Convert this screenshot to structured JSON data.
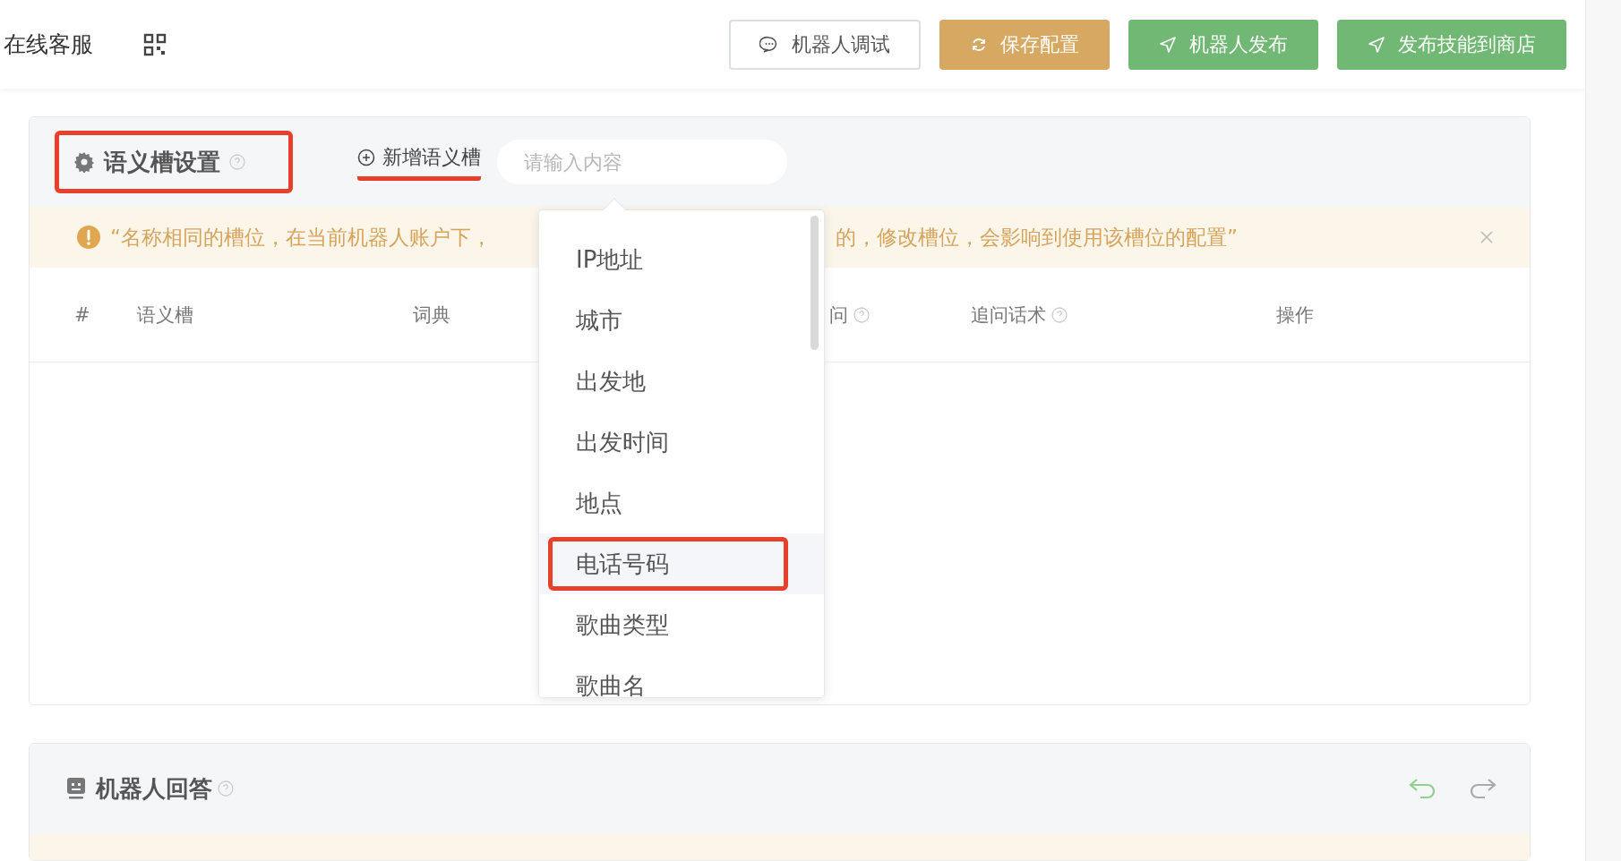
{
  "topbar": {
    "title": "在线客服",
    "buttons": [
      {
        "label": "机器人调试",
        "kind": "default"
      },
      {
        "label": "保存配置",
        "kind": "warning"
      },
      {
        "label": "机器人发布",
        "kind": "success"
      },
      {
        "label": "发布技能到商店",
        "kind": "success"
      }
    ]
  },
  "slot_section": {
    "title": "语义槽设置",
    "title_annotated": true,
    "add_link": {
      "label": "新增语义槽",
      "annotated": true
    },
    "search": {
      "placeholder": "请输入内容"
    },
    "notice": {
      "parts": [
        "“名称相同的槽位，在当前机器人账户下，",
        "的，修改槽位，会影响到使用该槽位的配置”"
      ]
    },
    "columns": [
      {
        "label": "#",
        "help": false
      },
      {
        "label": "语义槽",
        "help": false
      },
      {
        "label": "词典",
        "help": false
      },
      {
        "label": "问",
        "help": true
      },
      {
        "label": "追问话术",
        "help": true
      },
      {
        "label": "操作",
        "help": false
      }
    ],
    "dropdown": [
      {
        "label": "IP地址",
        "selected": false
      },
      {
        "label": "城市",
        "selected": false
      },
      {
        "label": "出发地",
        "selected": false
      },
      {
        "label": "出发时间",
        "selected": false
      },
      {
        "label": "地点",
        "selected": false
      },
      {
        "label": "电话号码",
        "selected": true
      },
      {
        "label": "歌曲类型",
        "selected": false
      },
      {
        "label": "歌曲名",
        "selected": false
      }
    ]
  },
  "answer_section": {
    "title": "机器人回答"
  }
}
